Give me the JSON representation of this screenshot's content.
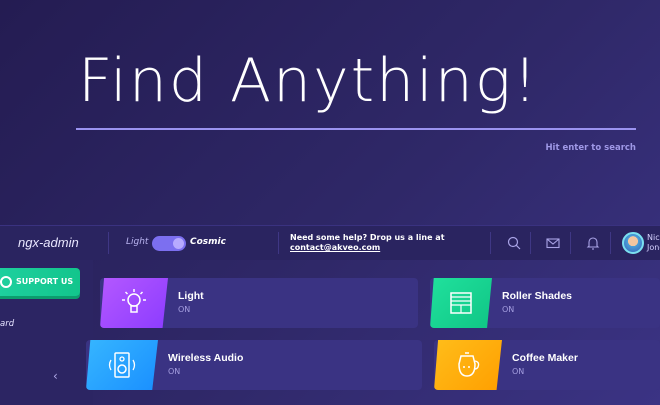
{
  "search": {
    "title": "Find Anything!",
    "hint": "Hit enter to search"
  },
  "header": {
    "brand": "ngx-admin",
    "theme_light": "Light",
    "theme_cosmic": "Cosmic",
    "help_line": "Need some help? Drop us a line at",
    "help_email": "contact@akveo.com",
    "user_name_line1": "Nick",
    "user_name_line2": "Jones",
    "icons": [
      "search-icon",
      "mail-icon",
      "bell-icon"
    ]
  },
  "sidebar": {
    "support_label": "SUPPORT US",
    "item_label": "ard",
    "collapse_icon": "chevron-left-icon"
  },
  "cards": [
    {
      "title": "Light",
      "state": "ON",
      "icon": "lightbulb-icon",
      "color": "#a44cff"
    },
    {
      "title": "Roller Shades",
      "state": "ON",
      "icon": "roller-shades-icon",
      "color": "#17d68f"
    },
    {
      "title": "Wireless Audio",
      "state": "ON",
      "icon": "speaker-icon",
      "color": "#26a9ff"
    },
    {
      "title": "Coffee Maker",
      "state": "ON",
      "icon": "coffee-maker-icon",
      "color": "#ffae00"
    }
  ],
  "colors": {
    "accent": "#7c6ff0",
    "background": "#2f2868",
    "card": "#3a3383"
  }
}
